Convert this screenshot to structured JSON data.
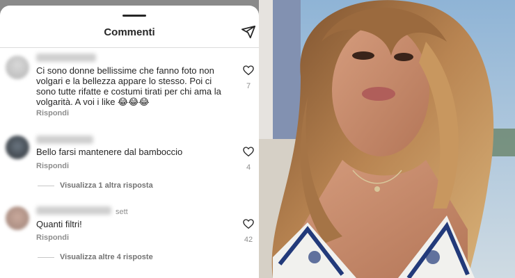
{
  "sheet": {
    "title": "Commenti",
    "share_icon": "send-icon"
  },
  "comments": [
    {
      "username_tail": "",
      "text": "Ci sono donne bellissime che fanno foto non volgari e la bellezza appare lo stesso. Poi ci sono tutte rifatte e costumi tirati per chi ama la volgarità. A voi i like 😂😂😂",
      "reply_label": "Rispondi",
      "likes": "7",
      "view_replies": ""
    },
    {
      "username_tail": "",
      "text": "Bello farsi mantenere dal bamboccio",
      "reply_label": "Rispondi",
      "likes": "4",
      "view_replies": "Visualizza 1 altra risposta"
    },
    {
      "username_tail": "sett",
      "text": "Quanti filtri!",
      "reply_label": "Rispondi",
      "likes": "42",
      "view_replies": "Visualizza altre 4 risposte"
    }
  ],
  "colors": {
    "text": "#262626",
    "muted": "#8e8e8e",
    "divider": "#dbdbdb"
  }
}
